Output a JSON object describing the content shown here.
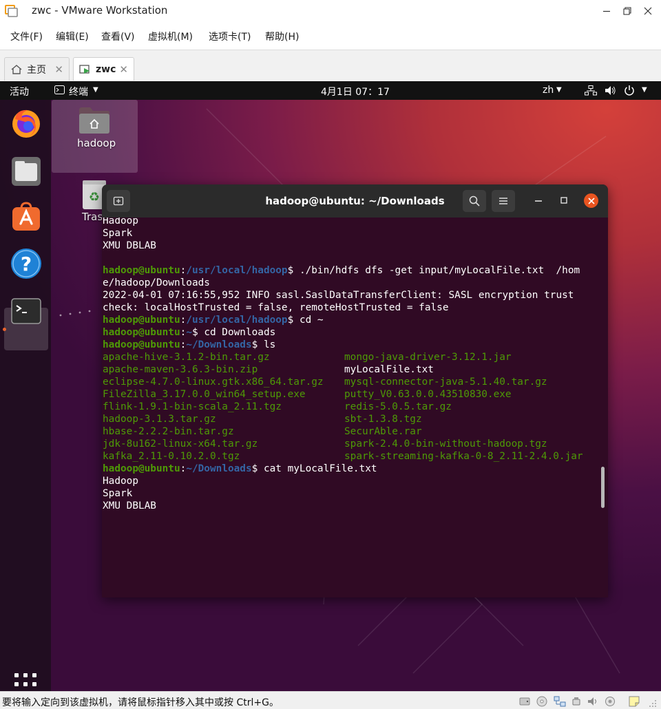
{
  "window": {
    "title": "zwc - VMware Workstation"
  },
  "menubar": {
    "items": [
      "文件(F)",
      "编辑(E)",
      "查看(V)",
      "虚拟机(M)",
      "选项卡(T)",
      "帮助(H)"
    ]
  },
  "tabs": [
    {
      "label": "主页"
    },
    {
      "label": "zwc"
    }
  ],
  "guest_topbar": {
    "activities": "活动",
    "app": "终端",
    "clock": "4月1日  07：17",
    "lang": "zh"
  },
  "desktop": {
    "icons": [
      {
        "label": "hadoop"
      },
      {
        "label": "Tras"
      }
    ]
  },
  "terminal": {
    "title": "hadoop@ubuntu: ~/Downloads",
    "prompt_user": "hadoop@ubuntu",
    "lines": [
      {
        "kind": "text",
        "text": "Hadoop"
      },
      {
        "kind": "text",
        "text": "Spark"
      },
      {
        "kind": "text",
        "text": "XMU DBLAB"
      },
      {
        "kind": "text",
        "text": ""
      },
      {
        "kind": "prompt",
        "path": "/usr/local/hadoop",
        "cmd": "./bin/hdfs dfs -get input/myLocalFile.txt  /hom"
      },
      {
        "kind": "text",
        "text": "e/hadoop/Downloads"
      },
      {
        "kind": "text",
        "text": "2022-04-01 07:16:55,952 INFO sasl.SaslDataTransferClient: SASL encryption trust"
      },
      {
        "kind": "text",
        "text": "check: localHostTrusted = false, remoteHostTrusted = false"
      },
      {
        "kind": "prompt",
        "path": "/usr/local/hadoop",
        "cmd": "cd ~"
      },
      {
        "kind": "prompt",
        "path": "~",
        "cmd": "cd Downloads"
      },
      {
        "kind": "prompt",
        "path": "~/Downloads",
        "cmd": "ls"
      },
      {
        "kind": "ls",
        "left": {
          "text": "apache-hive-3.1.2-bin.tar.gz",
          "green": true
        },
        "right": {
          "text": "mongo-java-driver-3.12.1.jar",
          "green": true
        }
      },
      {
        "kind": "ls",
        "left": {
          "text": "apache-maven-3.6.3-bin.zip",
          "green": true
        },
        "right": {
          "text": "myLocalFile.txt",
          "green": false
        }
      },
      {
        "kind": "ls",
        "left": {
          "text": "eclipse-4.7.0-linux.gtk.x86_64.tar.gz",
          "green": true
        },
        "right": {
          "text": "mysql-connector-java-5.1.40.tar.gz",
          "green": true
        }
      },
      {
        "kind": "ls",
        "left": {
          "text": "FileZilla_3.17.0.0_win64_setup.exe",
          "green": true
        },
        "right": {
          "text": "putty_V0.63.0.0.43510830.exe",
          "green": true
        }
      },
      {
        "kind": "ls",
        "left": {
          "text": "flink-1.9.1-bin-scala_2.11.tgz",
          "green": true
        },
        "right": {
          "text": "redis-5.0.5.tar.gz",
          "green": true
        }
      },
      {
        "kind": "ls",
        "left": {
          "text": "hadoop-3.1.3.tar.gz",
          "green": true
        },
        "right": {
          "text": "sbt-1.3.8.tgz",
          "green": true
        }
      },
      {
        "kind": "ls",
        "left": {
          "text": "hbase-2.2.2-bin.tar.gz",
          "green": true
        },
        "right": {
          "text": "SecurAble.rar",
          "green": true
        }
      },
      {
        "kind": "ls",
        "left": {
          "text": "jdk-8u162-linux-x64.tar.gz",
          "green": true
        },
        "right": {
          "text": "spark-2.4.0-bin-without-hadoop.tgz",
          "green": true
        }
      },
      {
        "kind": "ls",
        "left": {
          "text": "kafka_2.11-0.10.2.0.tgz",
          "green": true
        },
        "right": {
          "text": "spark-streaming-kafka-0-8_2.11-2.4.0.jar",
          "green": true
        }
      },
      {
        "kind": "prompt",
        "path": "~/Downloads",
        "cmd": "cat myLocalFile.txt"
      },
      {
        "kind": "text",
        "text": "Hadoop"
      },
      {
        "kind": "text",
        "text": "Spark"
      },
      {
        "kind": "text",
        "text": "XMU DBLAB"
      }
    ]
  },
  "statusbar": {
    "text": "要将输入定向到该虚拟机，请将鼠标指针移入其中或按 Ctrl+G。"
  },
  "colors": {
    "prompt_green": "#4e9a06",
    "path_blue": "#3465a4",
    "terminal_bg": "#300a24",
    "close_orange": "#e95420"
  }
}
